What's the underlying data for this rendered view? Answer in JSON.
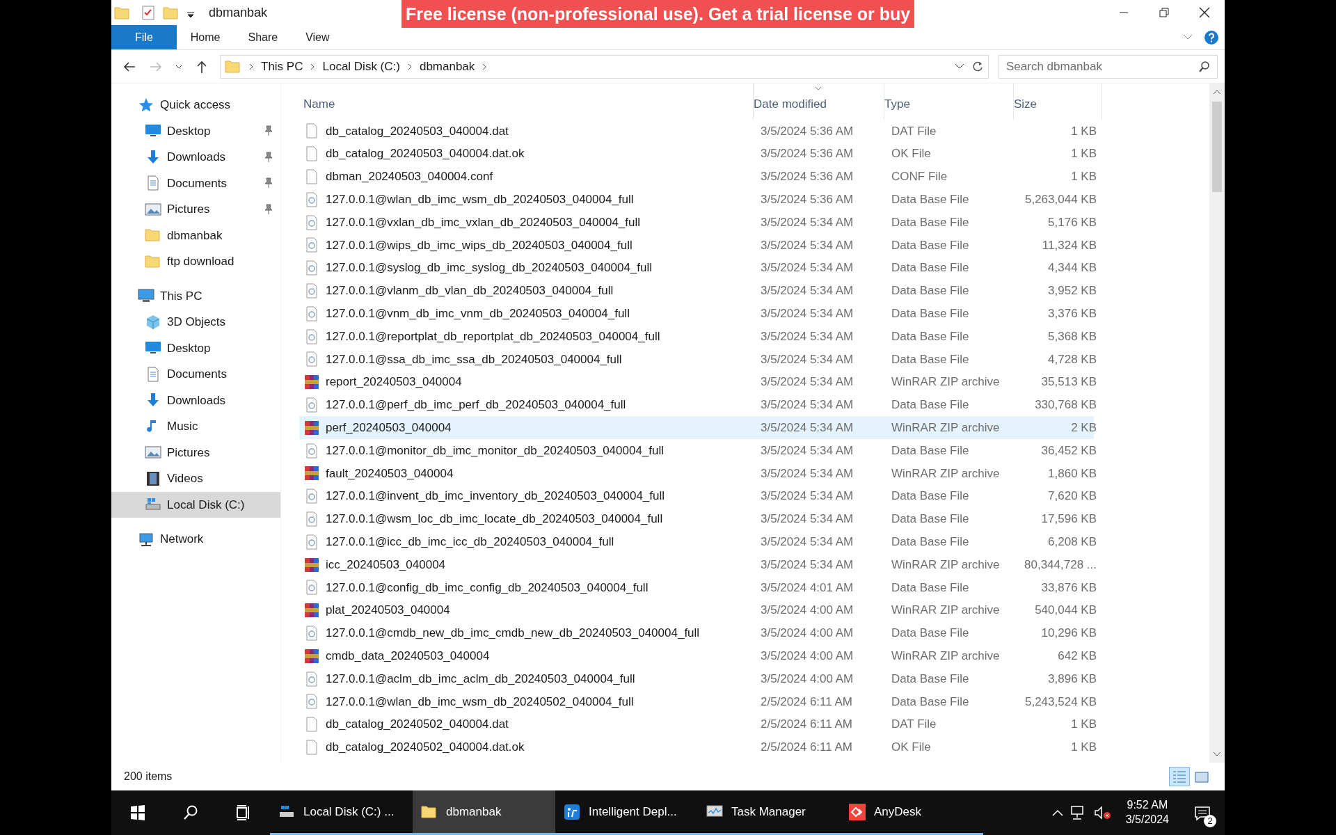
{
  "banner": {
    "text": "Free license (non-professional use). Get a trial license or buy"
  },
  "window": {
    "title": "dbmanbak"
  },
  "ribbon_tabs": [
    {
      "label": "File",
      "selected": true
    },
    {
      "label": "Home",
      "selected": false
    },
    {
      "label": "Share",
      "selected": false
    },
    {
      "label": "View",
      "selected": false
    }
  ],
  "address": {
    "crumbs": [
      "This PC",
      "Local Disk (C:)",
      "dbmanbak"
    ]
  },
  "search": {
    "placeholder": "Search dbmanbak"
  },
  "sidebar": [
    {
      "label": "Quick access",
      "kind": "star",
      "selected": false,
      "children": [
        {
          "label": "Desktop",
          "kind": "desktop",
          "pinned": true,
          "selected": false
        },
        {
          "label": "Downloads",
          "kind": "download",
          "pinned": true,
          "selected": false
        },
        {
          "label": "Documents",
          "kind": "document",
          "pinned": true,
          "selected": false
        },
        {
          "label": "Pictures",
          "kind": "picture",
          "pinned": true,
          "selected": false
        },
        {
          "label": "dbmanbak",
          "kind": "folder",
          "pinned": false,
          "selected": false
        },
        {
          "label": "ftp download",
          "kind": "folder",
          "pinned": false,
          "selected": false
        }
      ]
    },
    {
      "label": "This PC",
      "kind": "pc",
      "selected": false,
      "children": [
        {
          "label": "3D Objects",
          "kind": "cube",
          "pinned": false,
          "selected": false
        },
        {
          "label": "Desktop",
          "kind": "desktop",
          "pinned": false,
          "selected": false
        },
        {
          "label": "Documents",
          "kind": "document",
          "pinned": false,
          "selected": false
        },
        {
          "label": "Downloads",
          "kind": "download",
          "pinned": false,
          "selected": false
        },
        {
          "label": "Music",
          "kind": "music",
          "pinned": false,
          "selected": false
        },
        {
          "label": "Pictures",
          "kind": "picture",
          "pinned": false,
          "selected": false
        },
        {
          "label": "Videos",
          "kind": "video",
          "pinned": false,
          "selected": false
        },
        {
          "label": "Local Disk (C:)",
          "kind": "drive",
          "pinned": false,
          "selected": true
        }
      ]
    },
    {
      "label": "Network",
      "kind": "network",
      "selected": false
    }
  ],
  "columns": [
    "Name",
    "Date modified",
    "Type",
    "Size"
  ],
  "files": [
    {
      "name": "db_catalog_20240503_040004.dat",
      "date": "3/5/2024 5:36 AM",
      "type": "DAT File",
      "size": "1 KB",
      "kind": "blank",
      "selected": false
    },
    {
      "name": "db_catalog_20240503_040004.dat.ok",
      "date": "3/5/2024 5:36 AM",
      "type": "OK File",
      "size": "1 KB",
      "kind": "blank",
      "selected": false
    },
    {
      "name": "dbman_20240503_040004.conf",
      "date": "3/5/2024 5:36 AM",
      "type": "CONF File",
      "size": "1 KB",
      "kind": "blank",
      "selected": false
    },
    {
      "name": "127.0.0.1@wlan_db_imc_wsm_db_20240503_040004_full",
      "date": "3/5/2024 5:36 AM",
      "type": "Data Base File",
      "size": "5,263,044 KB",
      "kind": "db",
      "selected": false
    },
    {
      "name": "127.0.0.1@vxlan_db_imc_vxlan_db_20240503_040004_full",
      "date": "3/5/2024 5:34 AM",
      "type": "Data Base File",
      "size": "5,176 KB",
      "kind": "db",
      "selected": false
    },
    {
      "name": "127.0.0.1@wips_db_imc_wips_db_20240503_040004_full",
      "date": "3/5/2024 5:34 AM",
      "type": "Data Base File",
      "size": "11,324 KB",
      "kind": "db",
      "selected": false
    },
    {
      "name": "127.0.0.1@syslog_db_imc_syslog_db_20240503_040004_full",
      "date": "3/5/2024 5:34 AM",
      "type": "Data Base File",
      "size": "4,344 KB",
      "kind": "db",
      "selected": false
    },
    {
      "name": "127.0.0.1@vlanm_db_vlan_db_20240503_040004_full",
      "date": "3/5/2024 5:34 AM",
      "type": "Data Base File",
      "size": "3,952 KB",
      "kind": "db",
      "selected": false
    },
    {
      "name": "127.0.0.1@vnm_db_imc_vnm_db_20240503_040004_full",
      "date": "3/5/2024 5:34 AM",
      "type": "Data Base File",
      "size": "3,376 KB",
      "kind": "db",
      "selected": false
    },
    {
      "name": "127.0.0.1@reportplat_db_reportplat_db_20240503_040004_full",
      "date": "3/5/2024 5:34 AM",
      "type": "Data Base File",
      "size": "5,368 KB",
      "kind": "db",
      "selected": false
    },
    {
      "name": "127.0.0.1@ssa_db_imc_ssa_db_20240503_040004_full",
      "date": "3/5/2024 5:34 AM",
      "type": "Data Base File",
      "size": "4,728 KB",
      "kind": "db",
      "selected": false
    },
    {
      "name": "report_20240503_040004",
      "date": "3/5/2024 5:34 AM",
      "type": "WinRAR ZIP archive",
      "size": "35,513 KB",
      "kind": "rar",
      "selected": false
    },
    {
      "name": "127.0.0.1@perf_db_imc_perf_db_20240503_040004_full",
      "date": "3/5/2024 5:34 AM",
      "type": "Data Base File",
      "size": "330,768 KB",
      "kind": "db",
      "selected": false
    },
    {
      "name": "perf_20240503_040004",
      "date": "3/5/2024 5:34 AM",
      "type": "WinRAR ZIP archive",
      "size": "2 KB",
      "kind": "rar",
      "selected": true
    },
    {
      "name": "127.0.0.1@monitor_db_imc_monitor_db_20240503_040004_full",
      "date": "3/5/2024 5:34 AM",
      "type": "Data Base File",
      "size": "36,452 KB",
      "kind": "db",
      "selected": false
    },
    {
      "name": "fault_20240503_040004",
      "date": "3/5/2024 5:34 AM",
      "type": "WinRAR ZIP archive",
      "size": "1,860 KB",
      "kind": "rar",
      "selected": false
    },
    {
      "name": "127.0.0.1@invent_db_imc_inventory_db_20240503_040004_full",
      "date": "3/5/2024 5:34 AM",
      "type": "Data Base File",
      "size": "7,620 KB",
      "kind": "db",
      "selected": false
    },
    {
      "name": "127.0.0.1@wsm_loc_db_imc_locate_db_20240503_040004_full",
      "date": "3/5/2024 5:34 AM",
      "type": "Data Base File",
      "size": "17,596 KB",
      "kind": "db",
      "selected": false
    },
    {
      "name": "127.0.0.1@icc_db_imc_icc_db_20240503_040004_full",
      "date": "3/5/2024 5:34 AM",
      "type": "Data Base File",
      "size": "6,208 KB",
      "kind": "db",
      "selected": false
    },
    {
      "name": "icc_20240503_040004",
      "date": "3/5/2024 5:34 AM",
      "type": "WinRAR ZIP archive",
      "size": "80,344,728 ...",
      "kind": "rar",
      "selected": false
    },
    {
      "name": "127.0.0.1@config_db_imc_config_db_20240503_040004_full",
      "date": "3/5/2024 4:01 AM",
      "type": "Data Base File",
      "size": "33,876 KB",
      "kind": "db",
      "selected": false
    },
    {
      "name": "plat_20240503_040004",
      "date": "3/5/2024 4:00 AM",
      "type": "WinRAR ZIP archive",
      "size": "540,044 KB",
      "kind": "rar",
      "selected": false
    },
    {
      "name": "127.0.0.1@cmdb_new_db_imc_cmdb_new_db_20240503_040004_full",
      "date": "3/5/2024 4:00 AM",
      "type": "Data Base File",
      "size": "10,296 KB",
      "kind": "db",
      "selected": false
    },
    {
      "name": "cmdb_data_20240503_040004",
      "date": "3/5/2024 4:00 AM",
      "type": "WinRAR ZIP archive",
      "size": "642 KB",
      "kind": "rar",
      "selected": false
    },
    {
      "name": "127.0.0.1@aclm_db_imc_aclm_db_20240503_040004_full",
      "date": "3/5/2024 4:00 AM",
      "type": "Data Base File",
      "size": "3,896 KB",
      "kind": "db",
      "selected": false
    },
    {
      "name": "127.0.0.1@wlan_db_imc_wsm_db_20240502_040004_full",
      "date": "2/5/2024 6:11 AM",
      "type": "Data Base File",
      "size": "5,243,524 KB",
      "kind": "db",
      "selected": false
    },
    {
      "name": "db_catalog_20240502_040004.dat",
      "date": "2/5/2024 6:11 AM",
      "type": "DAT File",
      "size": "1 KB",
      "kind": "blank",
      "selected": false
    },
    {
      "name": "db_catalog_20240502_040004.dat.ok",
      "date": "2/5/2024 6:11 AM",
      "type": "OK File",
      "size": "1 KB",
      "kind": "blank",
      "selected": false
    }
  ],
  "status_bar": {
    "count": "200 items",
    "views": [
      {
        "kind": "details",
        "selected": true
      },
      {
        "kind": "thumbnails",
        "selected": false
      }
    ]
  },
  "taskbar": {
    "apps": [
      {
        "label": "Local Disk (C:) ...",
        "kind": "drive",
        "active": false
      },
      {
        "label": "dbmanbak",
        "kind": "folder",
        "active": true
      },
      {
        "label": "Intelligent Depl...",
        "kind": "deploy",
        "active": false
      },
      {
        "label": "Task Manager",
        "kind": "taskmgr",
        "active": false
      },
      {
        "label": "AnyDesk",
        "kind": "anydesk",
        "active": false
      }
    ],
    "time": "9:52 AM",
    "date": "3/5/2024",
    "notifications": "2"
  }
}
